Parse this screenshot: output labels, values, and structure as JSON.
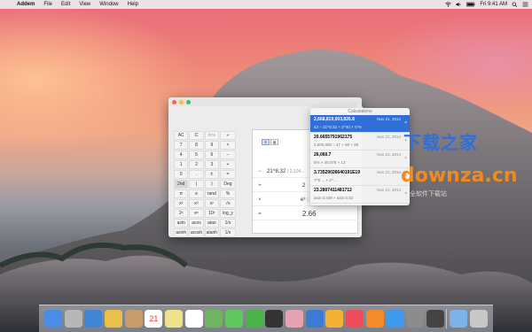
{
  "menubar": {
    "app_name": "Addem",
    "items": [
      "File",
      "Edit",
      "View",
      "Window",
      "Help"
    ],
    "clock": "Fri 9:41 AM"
  },
  "calculator": {
    "keys": [
      [
        "AC",
        "C",
        "Ans",
        "÷"
      ],
      [
        "7",
        "8",
        "9",
        "×"
      ],
      [
        "4",
        "5",
        "6",
        "−"
      ],
      [
        "1",
        "2",
        "3",
        "+"
      ],
      [
        "0",
        ".",
        "±",
        "="
      ],
      [
        "2nd",
        "(",
        ")",
        "Deg"
      ],
      [
        "π",
        "e",
        "rand",
        "%"
      ],
      [
        "x²",
        "x³",
        "xʸ",
        "√x"
      ],
      [
        "2ˣ",
        "eˣ",
        "10ˣ",
        "log_y"
      ],
      [
        "asin",
        "acos",
        "atan",
        "1/x"
      ],
      [
        "asinh",
        "acosh",
        "atanh",
        "1/x"
      ]
    ],
    "display_rows": [
      {
        "op": "",
        "value": "",
        "note": ""
      },
      {
        "op": "−",
        "value": "21^8.32",
        "note": "| 2.104..."
      },
      {
        "op": "+",
        "value": "2",
        "note": ""
      },
      {
        "op": "×",
        "value": "e³",
        "note": "| 1..."
      },
      {
        "op": "=",
        "value": "2.66",
        "note": ""
      }
    ]
  },
  "history": {
    "title": "Calculations",
    "items": [
      {
        "result": "2,668,819,003,826.8",
        "expr": "42 − 21^8.32 + 2^40 × π^e",
        "date": "Nov 21, 2014"
      },
      {
        "result": "20.6655791962175",
        "expr": "3,500,000 ÷ 47 + 60 + 80",
        "date": "Nov 21, 2014"
      },
      {
        "result": "26,060.7",
        "expr": "5% × 40,078 + 13",
        "date": "Nov 21, 2014"
      },
      {
        "result": "3.73529026640191E19",
        "expr": "7^8 ... × 2^....",
        "date": "Nov 21, 2014"
      },
      {
        "result": "23.2807411481712",
        "expr": "asin 0.448 + asin 0.02",
        "date": "Nov 21, 2014"
      }
    ]
  },
  "watermark": {
    "line1": "下载之家",
    "line2": "downza.cn",
    "line3": "全软件下载站"
  },
  "dock": {
    "icons": [
      "finder-icon",
      "launchpad-icon",
      "preview-icon",
      "notes-icon",
      "contacts-icon",
      "calendar-icon",
      "stickies-icon",
      "reminders-icon",
      "maps-icon",
      "messages-icon",
      "facetime-icon",
      "photobooth-icon",
      "photos-icon",
      "keynote-icon",
      "pages-icon",
      "music-icon",
      "ibooks-icon",
      "appstore-icon",
      "system-preferences-icon",
      "activity-icon",
      "downloads-icon",
      "trash-icon"
    ],
    "calendar_day": "21",
    "colors": [
      "#4a8de8",
      "#b7b7b7",
      "#3f87d6",
      "#e8c04a",
      "#c69c6d",
      "#ffffff",
      "#f0e28a",
      "#ffffff",
      "#6fb45f",
      "#5fc85f",
      "#47b547",
      "#333333",
      "#e6a3b4",
      "#3c7ad6",
      "#f4b136",
      "#f04b5a",
      "#f48b2a",
      "#3b9af0",
      "#8c8c8c",
      "#444444",
      "#7bb4ea",
      "#c8c8c8"
    ]
  }
}
